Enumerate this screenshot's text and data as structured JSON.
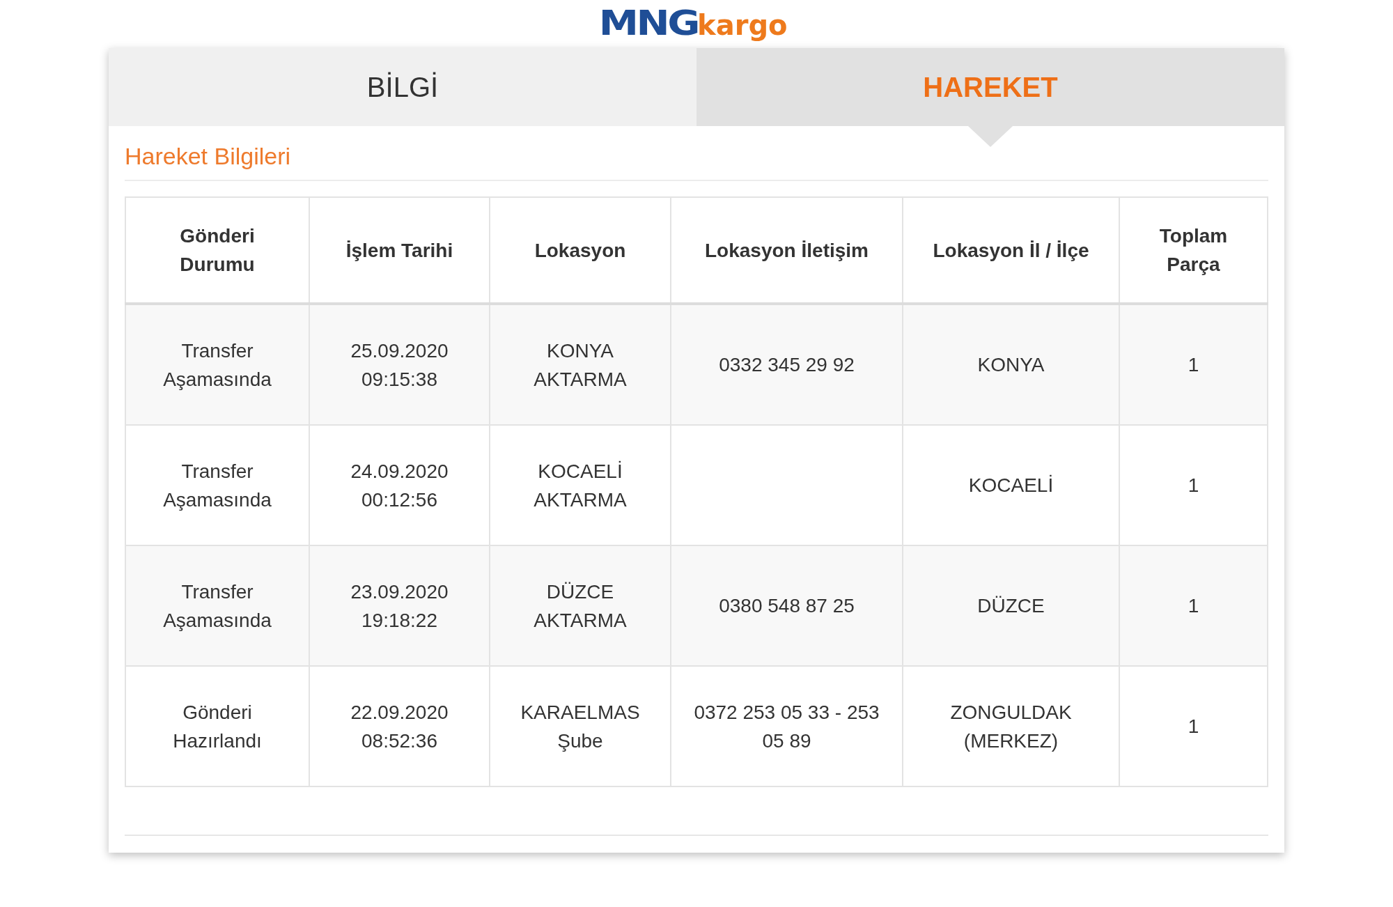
{
  "logo": {
    "brand": "MNG",
    "suffix": "kargo"
  },
  "tabs": [
    {
      "label": "BİLGİ",
      "selected": false
    },
    {
      "label": "HAREKET",
      "selected": true
    }
  ],
  "section_title": "Hareket Bilgileri",
  "table": {
    "columns": [
      "Gönderi Durumu",
      "İşlem Tarihi",
      "Lokasyon",
      "Lokasyon İletişim",
      "Lokasyon İl / İlçe",
      "Toplam Parça"
    ],
    "rows": [
      {
        "status": "Transfer Aşamasında",
        "date": "25.09.2020 09:15:38",
        "location": "KONYA AKTARMA",
        "contact": "0332 345 29 92",
        "city": "KONYA",
        "pieces": "1"
      },
      {
        "status": "Transfer Aşamasında",
        "date": "24.09.2020 00:12:56",
        "location": "KOCAELİ AKTARMA",
        "city": "KOCAELİ",
        "pieces": "1"
      },
      {
        "status": "Transfer Aşamasında",
        "date": "23.09.2020 19:18:22",
        "location": "DÜZCE AKTARMA",
        "contact": "0380 548 87 25",
        "city": "DÜZCE",
        "pieces": "1"
      },
      {
        "status": "Gönderi Hazırlandı",
        "date": "22.09.2020 08:52:36",
        "location": "KARAELMAS Şube",
        "contact": "0372 253 05 33 - 253 05 89",
        "city": "ZONGULDAK (MERKEZ)",
        "pieces": "1"
      }
    ]
  }
}
